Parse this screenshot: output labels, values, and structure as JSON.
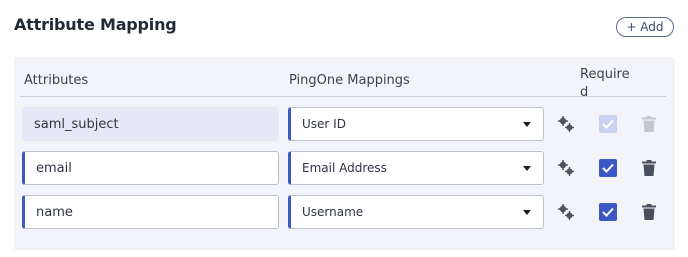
{
  "header": {
    "title": "Attribute Mapping",
    "add_label": "+ Add"
  },
  "table": {
    "columns": {
      "attributes": "Attributes",
      "mappings": "PingOne Mappings",
      "required": "Required"
    },
    "rows": [
      {
        "attribute": "saml_subject",
        "mapping": "User ID",
        "required": true,
        "editable": false
      },
      {
        "attribute": "email",
        "mapping": "Email Address",
        "required": true,
        "editable": true
      },
      {
        "attribute": "name",
        "mapping": "Username",
        "required": true,
        "editable": true
      }
    ]
  },
  "icons": {
    "settings": "gear-icon",
    "delete": "trash-icon",
    "dropdown": "caret-down-icon",
    "check": "check-icon"
  },
  "colors": {
    "accent": "#3d57c7",
    "disabled_check": "#c9d1ee",
    "panel": "#f3f4f9"
  }
}
